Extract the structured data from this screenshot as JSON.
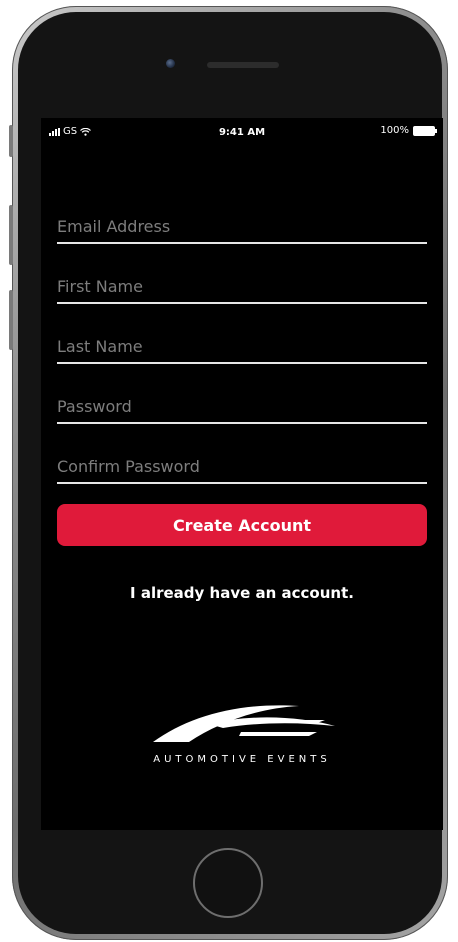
{
  "status_bar": {
    "carrier": "GS",
    "time": "9:41 AM",
    "battery": "100%"
  },
  "form": {
    "email_placeholder": "Email Address",
    "first_name_placeholder": "First Name",
    "last_name_placeholder": "Last Name",
    "password_placeholder": "Password",
    "confirm_password_placeholder": "Confirm Password"
  },
  "create_account_label": "Create Account",
  "have_account_link": "I already have an account.",
  "brand": {
    "name": "AUTOMOTIVE EVENTS",
    "logo_icon": "ae-swoosh-logo"
  },
  "colors": {
    "accent": "#e01a3a",
    "screen_bg": "#000000",
    "text": "#ffffff",
    "placeholder": "#7d7d7d"
  }
}
